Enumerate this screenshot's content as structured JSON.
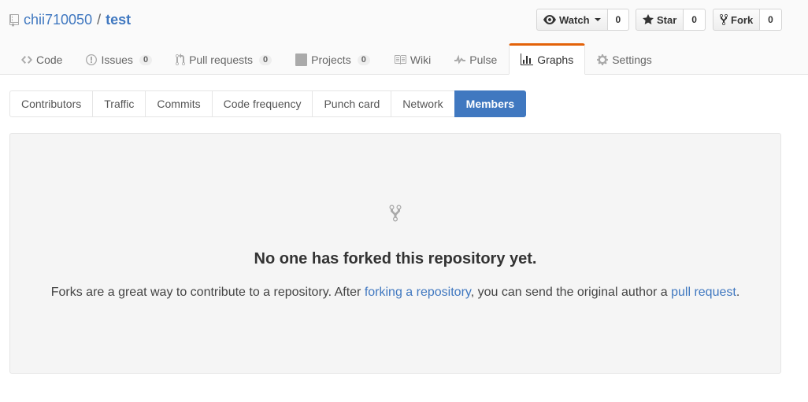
{
  "repo": {
    "owner": "chii710050",
    "separator": "/",
    "name": "test"
  },
  "actions": {
    "watch": {
      "label": "Watch",
      "count": "0"
    },
    "star": {
      "label": "Star",
      "count": "0"
    },
    "fork": {
      "label": "Fork",
      "count": "0"
    }
  },
  "nav": {
    "code": {
      "label": "Code"
    },
    "issues": {
      "label": "Issues",
      "count": "0"
    },
    "pulls": {
      "label": "Pull requests",
      "count": "0"
    },
    "projects": {
      "label": "Projects",
      "count": "0"
    },
    "wiki": {
      "label": "Wiki"
    },
    "pulse": {
      "label": "Pulse"
    },
    "graphs": {
      "label": "Graphs"
    },
    "settings": {
      "label": "Settings"
    }
  },
  "subnav": {
    "contributors": "Contributors",
    "traffic": "Traffic",
    "commits": "Commits",
    "code_frequency": "Code frequency",
    "punch_card": "Punch card",
    "network": "Network",
    "members": "Members"
  },
  "blankslate": {
    "heading": "No one has forked this repository yet.",
    "text_1": "Forks are a great way to contribute to a repository. After ",
    "link_1": "forking a repository",
    "text_2": ", you can send the original author a ",
    "link_2": "pull request",
    "text_3": "."
  },
  "colors": {
    "accent": "#4078c0",
    "selected_tab_border": "#e36209"
  }
}
